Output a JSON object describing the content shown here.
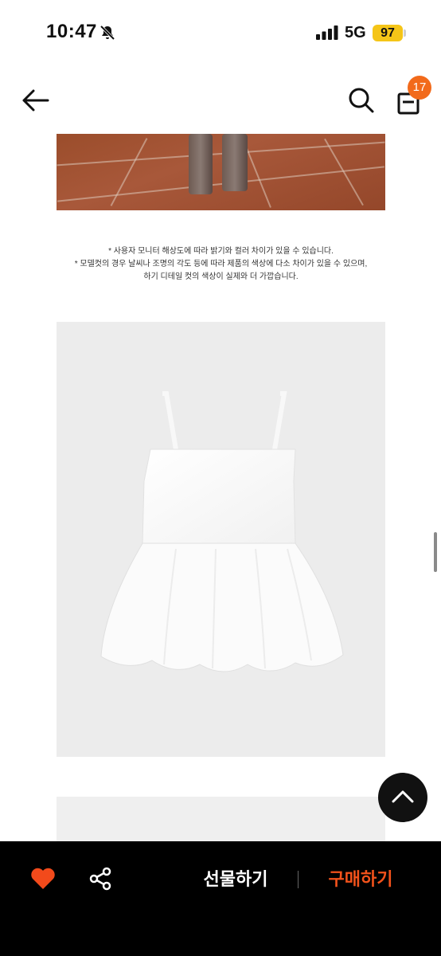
{
  "status": {
    "time": "10:47",
    "network": "5G",
    "battery": "97",
    "bell_icon": "bell-slash-icon",
    "signal_icon": "signal-bars-icon"
  },
  "header": {
    "back_icon": "arrow-left-icon",
    "search_icon": "search-icon",
    "cart_icon": "shopping-bag-icon",
    "cart_count": "17"
  },
  "notice": {
    "lines": [
      "* 사용자 모니터 해상도에 따라 밝기와 컬러 차이가 있을 수 있습니다.",
      "* 모델컷의 경우 날씨나 조명의 각도 등에 따라 제품의 색상에 다소 차이가 있을 수 있으며,",
      "하기 디테일 컷의 색상이 실제와 더 가깝습니다."
    ]
  },
  "bottom_bar": {
    "like_icon": "heart-icon",
    "share_icon": "share-icon",
    "gift_label": "선물하기",
    "buy_label": "구매하기"
  },
  "floating": {
    "to_top_icon": "chevron-up-icon"
  },
  "colors": {
    "accent": "#f26a1b",
    "buy": "#f2521b",
    "heart": "#f24a1b",
    "battery": "#f5c518"
  }
}
